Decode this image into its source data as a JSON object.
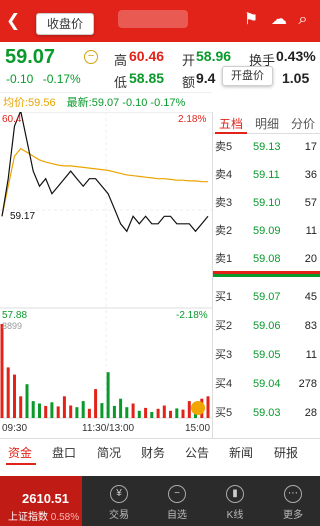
{
  "header": {
    "back_icon": "back-arrow-icon",
    "tooltip": "收盘价",
    "icons": [
      "flag-icon",
      "cloud-icon",
      "search-icon"
    ]
  },
  "quote": {
    "price": "59.07",
    "change": "-0.10",
    "change_pct": "-0.17%",
    "high_label": "高",
    "high": "60.46",
    "open_label": "开",
    "open": "58.96",
    "turnover_label": "换手",
    "turnover": "0.43%",
    "low_label": "低",
    "low": "58.85",
    "amount_label": "额",
    "amount": "9.4",
    "ratio": "1.05",
    "tooltip": "开盘价"
  },
  "info_line": {
    "avg": "均价:59.56",
    "latest": "最新:59.07 -0.10 -0.17%"
  },
  "chart_data": {
    "type": "line",
    "top_price": "60.4",
    "top_pct": "2.18%",
    "base_price": "59.17",
    "bottom_price": "57.88",
    "bottom_pct": "-2.18%",
    "volume_max": "3899",
    "x_labels": [
      "09:30",
      "11:30/13:00",
      "15:00"
    ],
    "price_series": [
      59.1,
      59.6,
      60.3,
      60.5,
      60.1,
      59.7,
      59.5,
      59.6,
      59.4,
      59.5,
      59.6,
      59.7,
      59.6,
      59.5,
      59.6,
      59.6,
      59.5,
      59.4,
      59.2,
      59.0,
      58.9,
      59.1,
      59.0,
      59.1,
      59.0,
      59.0,
      59.1,
      59.1,
      59.0,
      59.0,
      59.0,
      58.9,
      59.0,
      59.1
    ],
    "avg_series": [
      59.1,
      59.5,
      59.9,
      60.0,
      59.95,
      59.9,
      59.85,
      59.82,
      59.8,
      59.78,
      59.77,
      59.77,
      59.76,
      59.75,
      59.74,
      59.73,
      59.72,
      59.71,
      59.69,
      59.67,
      59.65,
      59.64,
      59.63,
      59.62,
      59.61,
      59.6,
      59.6,
      59.59,
      59.58,
      59.58,
      59.57,
      59.57,
      59.56,
      59.56
    ],
    "volume_series": [
      3899,
      2100,
      1800,
      900,
      1400,
      700,
      600,
      500,
      650,
      480,
      900,
      520,
      450,
      700,
      380,
      1200,
      620,
      1900,
      500,
      800,
      450,
      600,
      300,
      420,
      250,
      380,
      520,
      300,
      400,
      350,
      700,
      450,
      800,
      900
    ],
    "ylim": [
      57.88,
      60.46
    ]
  },
  "order_book": {
    "tabs": [
      "五档",
      "明细",
      "分价"
    ],
    "sell": [
      {
        "label": "卖5",
        "price": "59.13",
        "vol": "17"
      },
      {
        "label": "卖4",
        "price": "59.11",
        "vol": "36"
      },
      {
        "label": "卖3",
        "price": "59.10",
        "vol": "57"
      },
      {
        "label": "卖2",
        "price": "59.09",
        "vol": "11"
      },
      {
        "label": "卖1",
        "price": "59.08",
        "vol": "20"
      }
    ],
    "buy": [
      {
        "label": "买1",
        "price": "59.07",
        "vol": "45"
      },
      {
        "label": "买2",
        "price": "59.06",
        "vol": "83"
      },
      {
        "label": "买3",
        "price": "59.05",
        "vol": "11"
      },
      {
        "label": "买4",
        "price": "59.04",
        "vol": "278"
      },
      {
        "label": "买5",
        "price": "59.03",
        "vol": "28"
      }
    ]
  },
  "info_tabs": [
    "资金",
    "盘口",
    "简况",
    "财务",
    "公告",
    "新闻",
    "研报"
  ],
  "footer": {
    "index_value": "2610.51",
    "index_name": "上证指数",
    "index_change": "0.58%",
    "buttons": [
      {
        "label": "交易",
        "icon": "yen-icon"
      },
      {
        "label": "自选",
        "icon": "minus-circle-icon"
      },
      {
        "label": "K线",
        "icon": "kline-icon"
      },
      {
        "label": "更多",
        "icon": "more-icon"
      }
    ]
  }
}
